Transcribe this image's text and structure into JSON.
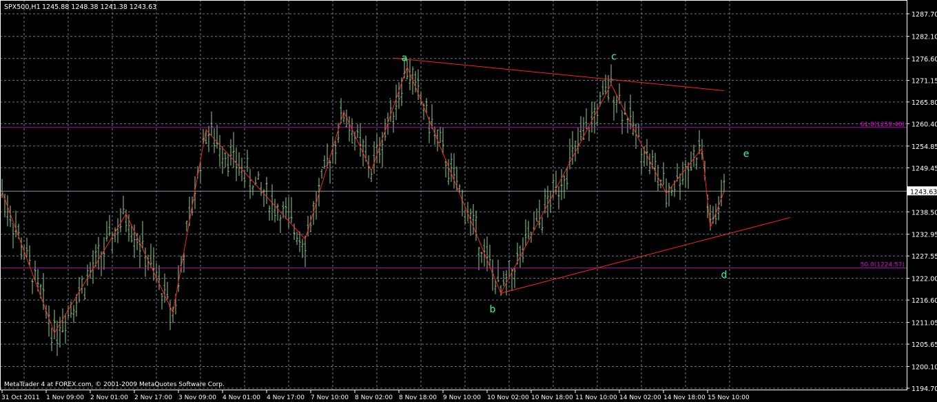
{
  "header": {
    "symbol": "SPX500,H1",
    "ohlc": "1245.88 1248.38 1241.38 1243.63"
  },
  "footer": {
    "copyright": "MetaTrader 4 at FOREX.com, © 2001-2009 MetaQuotes Software Corp."
  },
  "colors": {
    "background": "#000000",
    "grid": "#6a7a8a",
    "bars": "#8fd08f",
    "zigzag": "#ff2020",
    "fib": "#e000e0",
    "wave_labels": "#33ff99",
    "axis": "#ffffff"
  },
  "chart_data": {
    "type": "bar",
    "title": "SPX500,H1",
    "ylim": [
      1194.7,
      1287.7
    ],
    "grid": true,
    "y_ticks": [
      "1287.70",
      "1282.10",
      "1276.60",
      "1271.15",
      "1265.80",
      "1260.40",
      "1254.85",
      "1249.45",
      "1238.50",
      "1232.95",
      "1227.55",
      "1222.00",
      "1216.60",
      "1211.05",
      "1205.65",
      "1200.10",
      "1194.70"
    ],
    "current_price": "1243.63",
    "x_ticks": [
      "31 Oct 2011",
      "1 Nov 09:00",
      "2 Nov 01:00",
      "2 Nov 17:00",
      "3 Nov 09:00",
      "4 Nov 01:00",
      "4 Nov 17:00",
      "7 Nov 10:00",
      "8 Nov 02:00",
      "8 Nov 18:00",
      "9 Nov 10:00",
      "10 Nov 02:00",
      "10 Nov 18:00",
      "11 Nov 10:00",
      "14 Nov 02:00",
      "14 Nov 18:00",
      "15 Nov 10:00"
    ],
    "bars_per_tick": 16,
    "zigzag": [
      {
        "bar": 0,
        "price": 1243.5
      },
      {
        "bar": 19,
        "price": 1208.4
      },
      {
        "bar": 45,
        "price": 1238.0
      },
      {
        "bar": 62,
        "price": 1213.5
      },
      {
        "bar": 74,
        "price": 1258.9
      },
      {
        "bar": 110,
        "price": 1231.7
      },
      {
        "bar": 124,
        "price": 1263.4
      },
      {
        "bar": 134,
        "price": 1248.7
      },
      {
        "bar": 147,
        "price": 1274.5
      },
      {
        "bar": 181,
        "price": 1218.3
      },
      {
        "bar": 221,
        "price": 1270.2
      },
      {
        "bar": 241,
        "price": 1243.1
      },
      {
        "bar": 254,
        "price": 1254.3
      },
      {
        "bar": 257,
        "price": 1234.6
      },
      {
        "bar": 262,
        "price": 1243.6
      }
    ],
    "trendlines": [
      {
        "name": "upper",
        "from": {
          "bar": 142,
          "price": 1276.7
        },
        "to": {
          "bar": 262,
          "price": 1268.6
        }
      },
      {
        "name": "lower",
        "from": {
          "bar": 181,
          "price": 1218.3
        },
        "to": {
          "bar": 286,
          "price": 1237.1
        }
      }
    ],
    "fib_levels": [
      {
        "label": "61.8(1259.48)",
        "price": 1259.48
      },
      {
        "label": "50.0(1224.57)",
        "price": 1224.57
      }
    ],
    "wave_labels": [
      {
        "text": "a",
        "bar": 146,
        "price": 1276.0
      },
      {
        "text": "b",
        "bar": 178,
        "price": 1213.5
      },
      {
        "text": "c",
        "bar": 222,
        "price": 1276.3
      },
      {
        "text": "d",
        "bar": 262,
        "price": 1222.1
      },
      {
        "text": "e",
        "bar": 270,
        "price": 1252.2
      }
    ]
  }
}
